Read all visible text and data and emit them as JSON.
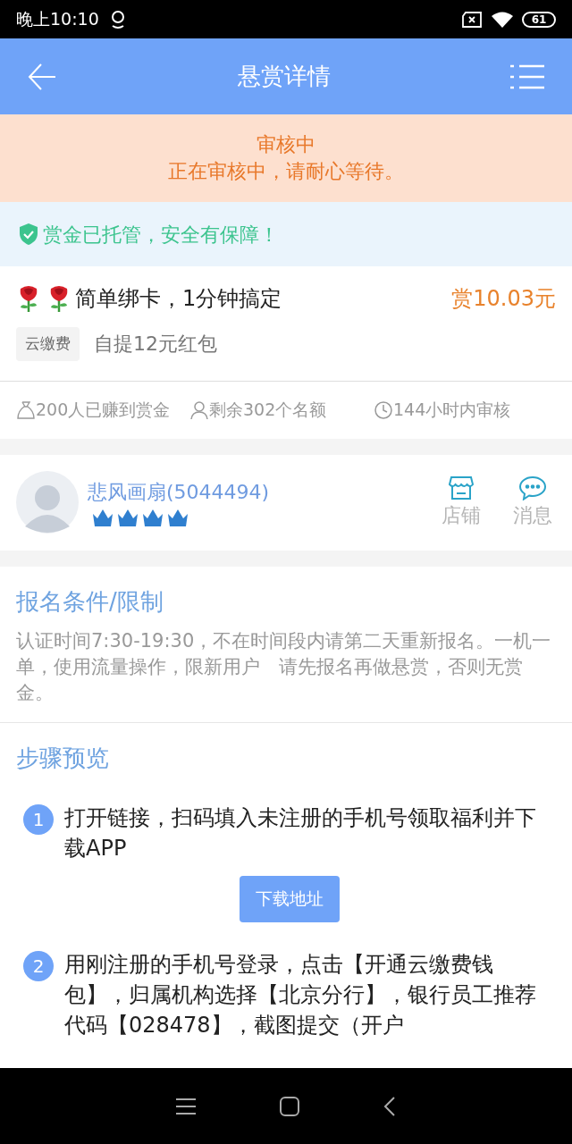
{
  "status_bar": {
    "time": "晚上10:10",
    "battery": "61"
  },
  "header": {
    "title": "悬赏详情"
  },
  "review_banner": {
    "title": "审核中",
    "message": "正在审核中，请耐心等待。"
  },
  "guarantee_banner": {
    "text": "赏金已托管，安全有保障！"
  },
  "task": {
    "title": "简单绑卡，1分钟搞定",
    "reward": "赏10.03元",
    "tag": "云缴费",
    "subtitle": "自提12元红包"
  },
  "stats": [
    {
      "kind": "money",
      "text": "200人已赚到赏金"
    },
    {
      "kind": "person",
      "text": "剩余302个名额"
    },
    {
      "kind": "clock",
      "text": "144小时内审核"
    }
  ],
  "publisher": {
    "name": "悲风画扇(5044494)",
    "stars": 4,
    "actions": [
      {
        "kind": "shop",
        "label": "店铺"
      },
      {
        "kind": "message",
        "label": "消息"
      }
    ]
  },
  "conditions": {
    "heading": "报名条件/限制",
    "text": "认证时间7:30-19:30，不在时间段内请第二天重新报名。一机一单，使用流量操作，限新用户　请先报名再做悬赏，否则无赏金。"
  },
  "steps": {
    "heading": "步骤预览",
    "items": [
      {
        "number": "1",
        "text": "打开链接，扫码填入未注册的手机号领取福利并下载APP",
        "button": "下载地址"
      },
      {
        "number": "2",
        "text": "用刚注册的手机号登录，点击【开通云缴费钱包】，归属机构选择【北京分行】，银行员工推荐代码【028478】，截图提交（开户"
      }
    ]
  }
}
